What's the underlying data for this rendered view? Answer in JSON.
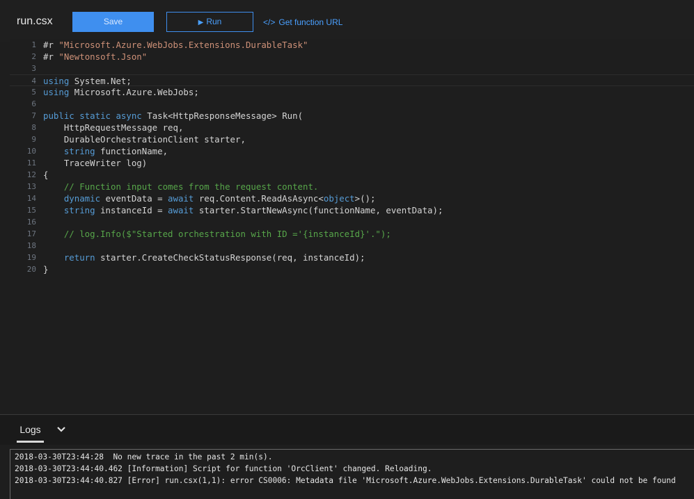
{
  "toolbar": {
    "file_name": "run.csx",
    "save_label": "Save",
    "run_label": "Run",
    "get_url_icon": "</>",
    "get_url_label": "Get function URL"
  },
  "editor": {
    "lines": [
      [
        {
          "t": "#r ",
          "c": ""
        },
        {
          "t": "\"Microsoft.Azure.WebJobs.Extensions.DurableTask\"",
          "c": "s"
        }
      ],
      [
        {
          "t": "#r ",
          "c": ""
        },
        {
          "t": "\"Newtonsoft.Json\"",
          "c": "s"
        }
      ],
      [],
      [
        {
          "t": "using",
          "c": "k"
        },
        {
          "t": " System.Net;",
          "c": ""
        }
      ],
      [
        {
          "t": "using",
          "c": "k"
        },
        {
          "t": " Microsoft.Azure.WebJobs;",
          "c": ""
        }
      ],
      [],
      [
        {
          "t": "public",
          "c": "k"
        },
        {
          "t": " ",
          "c": ""
        },
        {
          "t": "static",
          "c": "k"
        },
        {
          "t": " ",
          "c": ""
        },
        {
          "t": "async",
          "c": "k"
        },
        {
          "t": " Task<HttpResponseMessage> Run(",
          "c": ""
        }
      ],
      [
        {
          "t": "    HttpRequestMessage req,",
          "c": ""
        }
      ],
      [
        {
          "t": "    DurableOrchestrationClient starter,",
          "c": ""
        }
      ],
      [
        {
          "t": "    ",
          "c": ""
        },
        {
          "t": "string",
          "c": "k"
        },
        {
          "t": " functionName,",
          "c": ""
        }
      ],
      [
        {
          "t": "    TraceWriter log)",
          "c": ""
        }
      ],
      [
        {
          "t": "{",
          "c": ""
        }
      ],
      [
        {
          "t": "    ",
          "c": ""
        },
        {
          "t": "// Function input comes from the request content.",
          "c": "c"
        }
      ],
      [
        {
          "t": "    ",
          "c": ""
        },
        {
          "t": "dynamic",
          "c": "k"
        },
        {
          "t": " eventData = ",
          "c": ""
        },
        {
          "t": "await",
          "c": "k"
        },
        {
          "t": " req.Content.ReadAsAsync<",
          "c": ""
        },
        {
          "t": "object",
          "c": "k"
        },
        {
          "t": ">();",
          "c": ""
        }
      ],
      [
        {
          "t": "    ",
          "c": ""
        },
        {
          "t": "string",
          "c": "k"
        },
        {
          "t": " instanceId = ",
          "c": ""
        },
        {
          "t": "await",
          "c": "k"
        },
        {
          "t": " starter.StartNewAsync(functionName, eventData);",
          "c": ""
        }
      ],
      [],
      [
        {
          "t": "    ",
          "c": ""
        },
        {
          "t": "// log.Info($\"Started orchestration with ID ='{instanceId}'.\");",
          "c": "c"
        }
      ],
      [],
      [
        {
          "t": "    ",
          "c": ""
        },
        {
          "t": "return",
          "c": "k"
        },
        {
          "t": " starter.CreateCheckStatusResponse(req, instanceId);",
          "c": ""
        }
      ],
      [
        {
          "t": "}",
          "c": ""
        }
      ]
    ]
  },
  "logs": {
    "tab_label": "Logs",
    "chevron_icon": "chevron-down-icon",
    "entries": [
      "2018-03-30T23:44:28  No new trace in the past 2 min(s).",
      "2018-03-30T23:44:40.462 [Information] Script for function 'OrcClient' changed. Reloading.",
      "2018-03-30T23:44:40.827 [Error] run.csx(1,1): error CS0006: Metadata file 'Microsoft.Azure.WebJobs.Extensions.DurableTask' could not be found"
    ]
  },
  "colors": {
    "accent": "#3f8fef",
    "keyword": "#569cd6",
    "string": "#ce9178",
    "comment": "#57a64a"
  }
}
